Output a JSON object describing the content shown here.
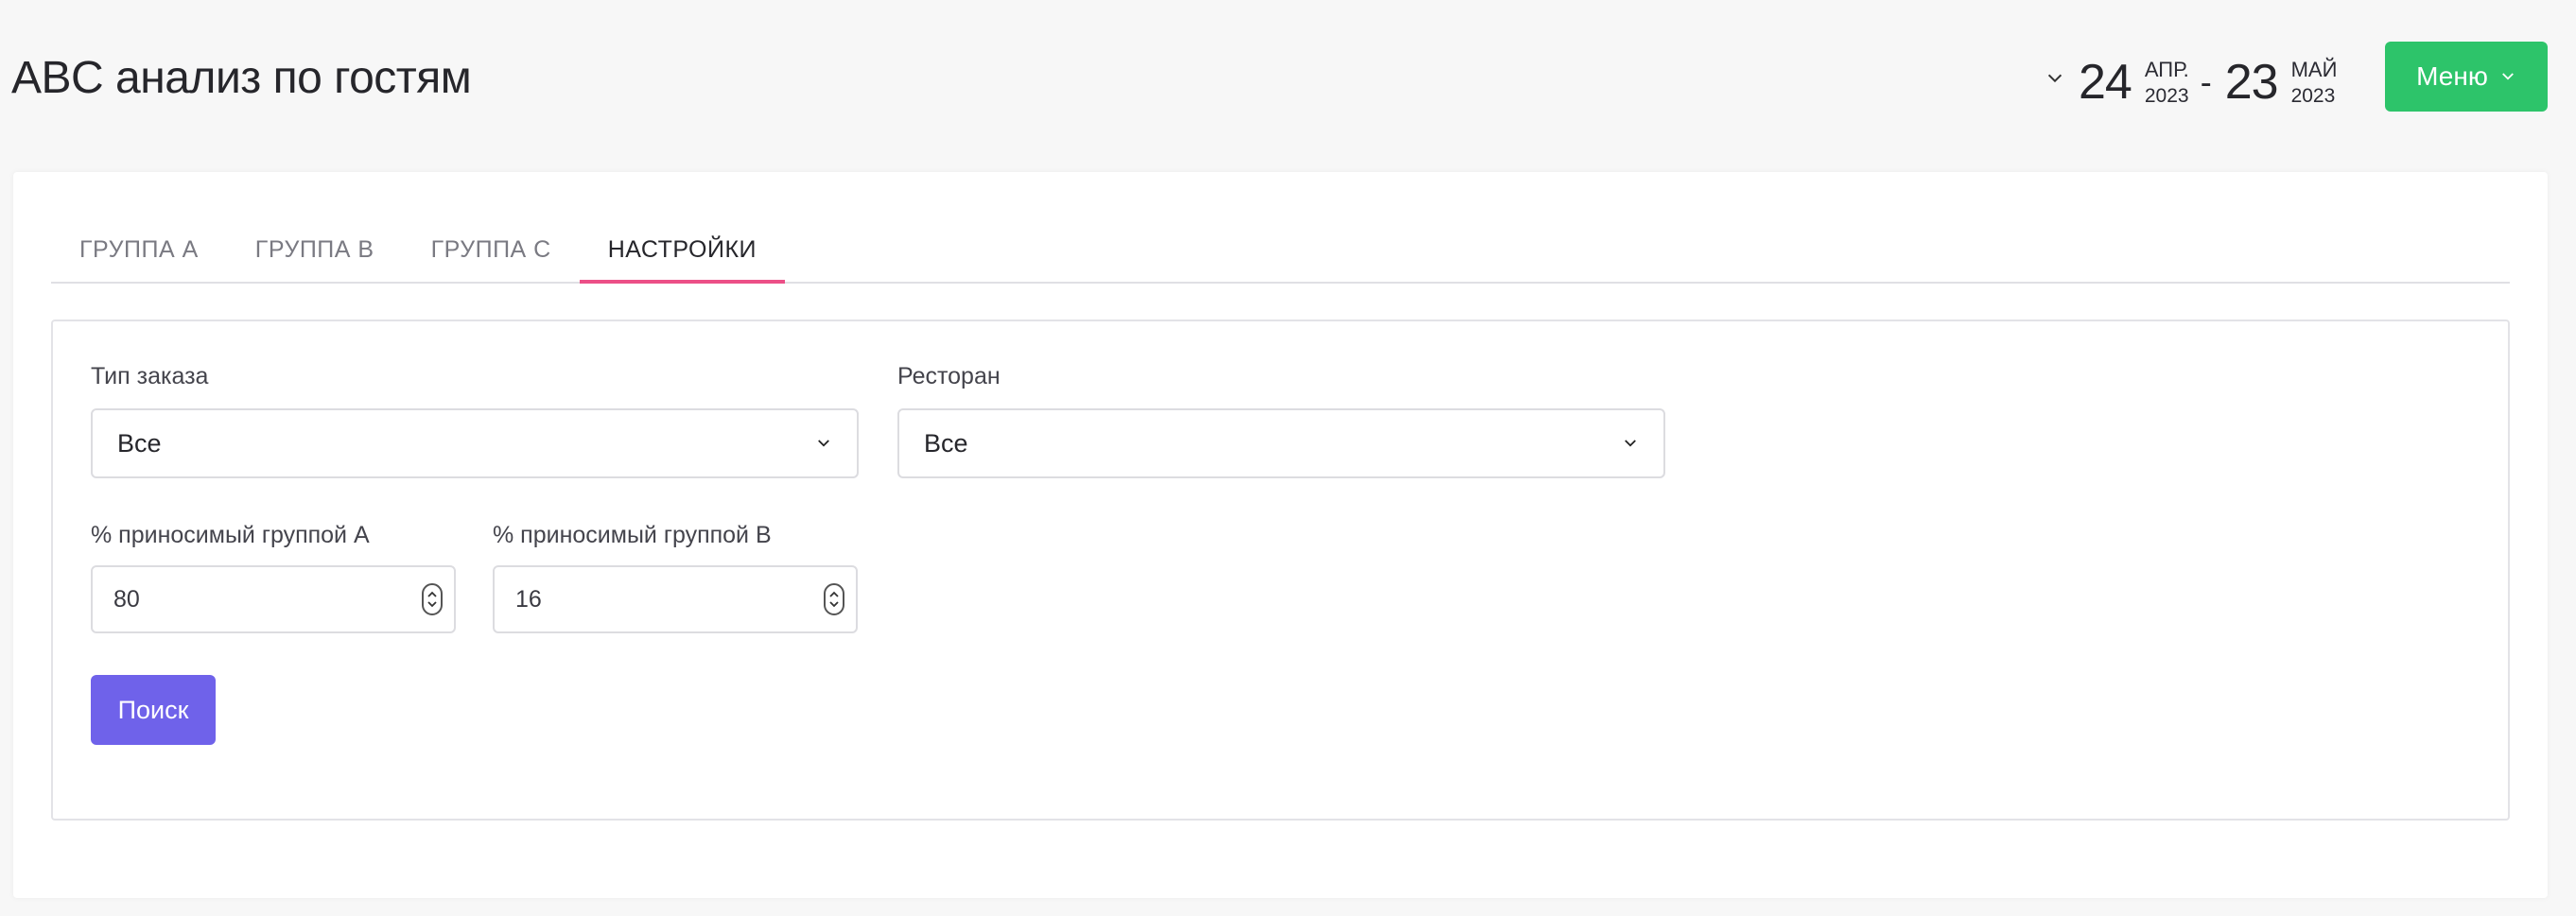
{
  "header": {
    "title": "ABC анализ по гостям",
    "date_range": {
      "start": {
        "day": "24",
        "month": "АПР.",
        "year": "2023"
      },
      "separator": "-",
      "end": {
        "day": "23",
        "month": "МАЙ",
        "year": "2023"
      }
    },
    "menu_label": "Меню"
  },
  "tabs": [
    {
      "label": "ГРУППА А",
      "active": false
    },
    {
      "label": "ГРУППА В",
      "active": false
    },
    {
      "label": "ГРУППА С",
      "active": false
    },
    {
      "label": "НАСТРОЙКИ",
      "active": true
    }
  ],
  "settings": {
    "order_type": {
      "label": "Тип заказа",
      "value": "Все"
    },
    "restaurant": {
      "label": "Ресторан",
      "value": "Все"
    },
    "group_a_percent": {
      "label": "% приносимый группой А",
      "value": "80"
    },
    "group_b_percent": {
      "label": "% приносимый группой В",
      "value": "16"
    },
    "search_label": "Поиск"
  },
  "icons": {
    "date_toggle": "chevron-down-icon",
    "menu_toggle": "chevron-down-icon",
    "select_toggle": "chevron-down-icon",
    "stepper": "spinner-up-down-icon"
  },
  "colors": {
    "menu_button": "#2dc46a",
    "active_tab_underline": "#ec4f87",
    "search_button": "#6f62ea"
  }
}
